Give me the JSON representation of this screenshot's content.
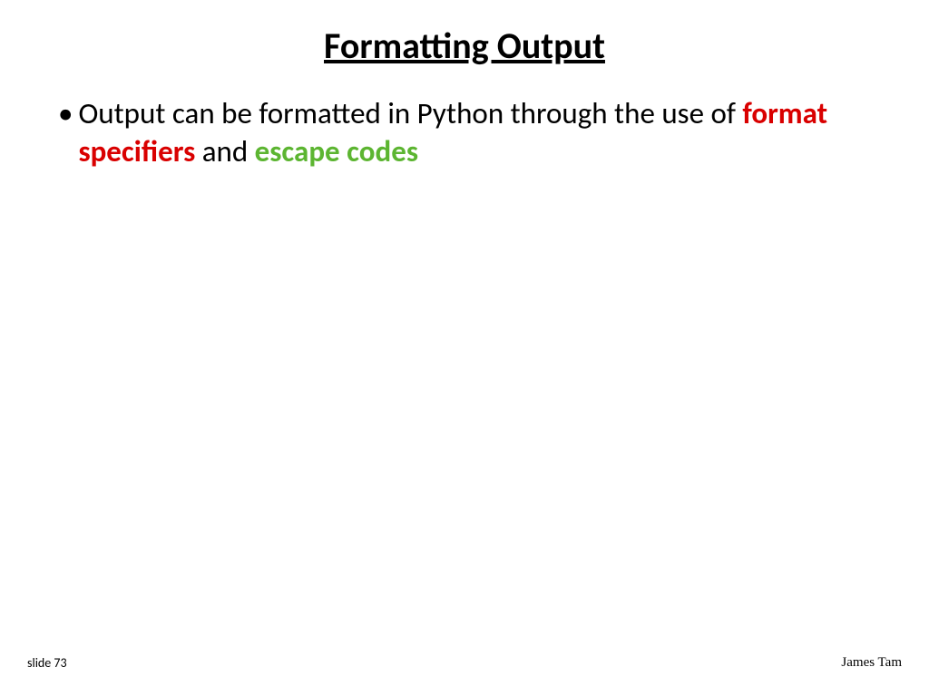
{
  "slide": {
    "title": "Formatting Output",
    "bullet": {
      "mark": "•",
      "seg1": "Output can be formatted in Python through the use of ",
      "seg2_red": "format specifiers",
      "seg3": " and ",
      "seg4_green": "escape codes"
    },
    "footer_left": "slide 73",
    "footer_right": "James Tam"
  }
}
